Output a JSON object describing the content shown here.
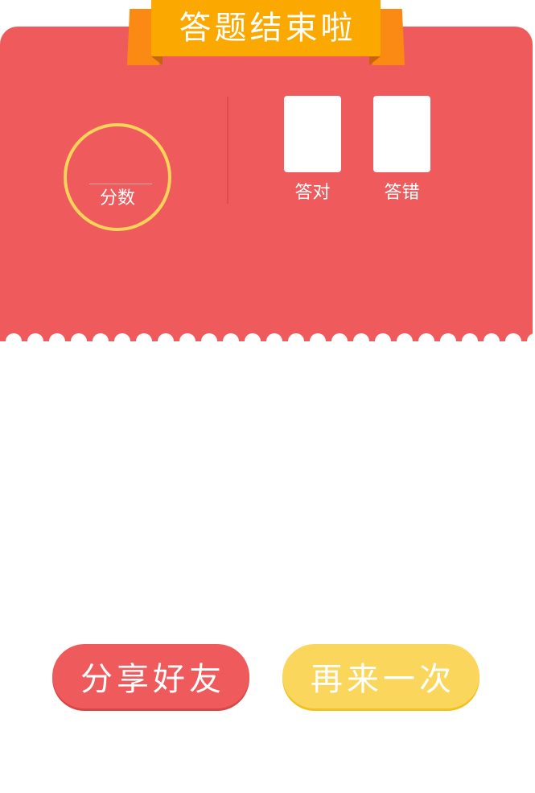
{
  "banner": {
    "title": "答题结束啦"
  },
  "score": {
    "value": "",
    "label": "分数"
  },
  "stats": {
    "correct": {
      "value": "",
      "label": "答对"
    },
    "wrong": {
      "value": "",
      "label": "答错"
    }
  },
  "actions": {
    "share_label": "分享好友",
    "retry_label": "再来一次"
  },
  "colors": {
    "card": "#ef5b5c",
    "ribbon": "#fba800",
    "ribbon_tail": "#fb8a15",
    "ring": "#fdd45a",
    "retry_button": "#fbd65c",
    "background": "#ffffff"
  }
}
